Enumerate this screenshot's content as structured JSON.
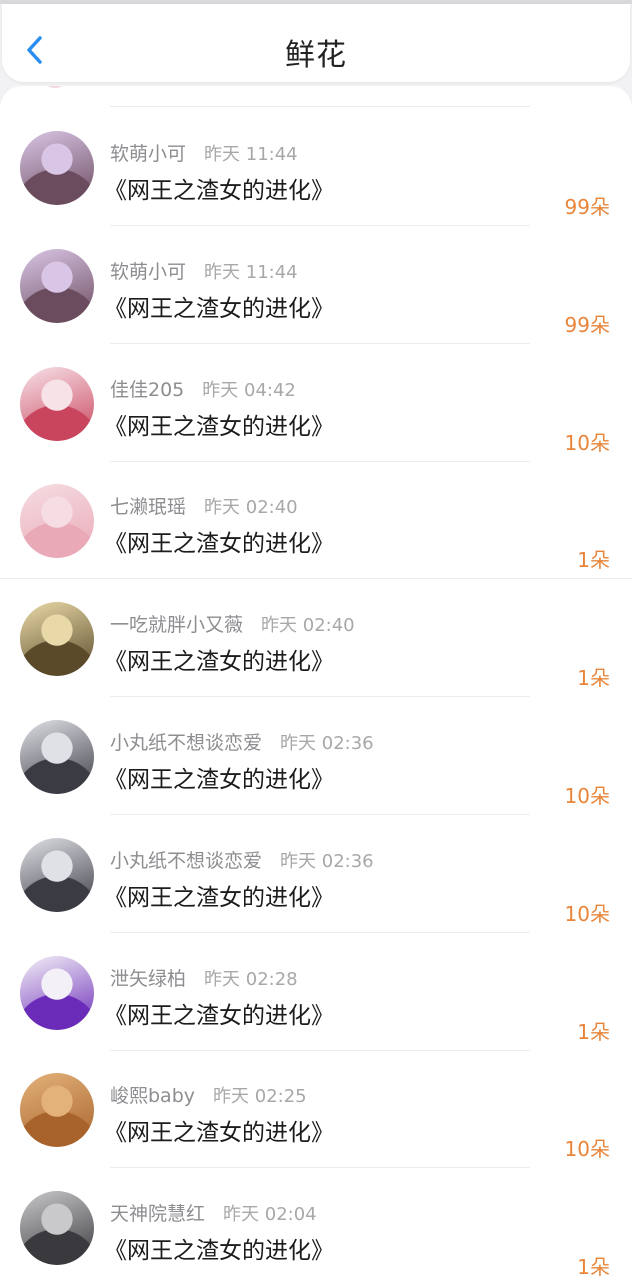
{
  "header": {
    "title": "鲜花",
    "back_icon": "chevron-left-icon",
    "accent": "#2a8ef0"
  },
  "colors": {
    "count": "#e8853a",
    "name": "#8e8e92"
  },
  "items": [
    {
      "name": "软萌小可",
      "time": "昨天 11:44",
      "book": "《网王之渣女的进化》",
      "count": "99朵",
      "avatar": "anime-girl-avatar",
      "palette": [
        "#d9c6e6",
        "#6b4b5e"
      ]
    },
    {
      "name": "软萌小可",
      "time": "昨天 11:44",
      "book": "《网王之渣女的进化》",
      "count": "99朵",
      "avatar": "anime-girl-avatar",
      "palette": [
        "#d9c6e6",
        "#6b4b5e"
      ]
    },
    {
      "name": "佳佳205",
      "time": "昨天 04:42",
      "book": "《网王之渣女的进化》",
      "count": "10朵",
      "avatar": "flower-girl-avatar",
      "palette": [
        "#f7e2e8",
        "#c9455e"
      ]
    },
    {
      "name": "七濑珉瑶",
      "time": "昨天 02:40",
      "book": "《网王之渣女的进化》",
      "count": "1朵",
      "avatar": "pink-hair-avatar",
      "palette": [
        "#f6dde3",
        "#e9a9b6"
      ]
    },
    {
      "name": "一吃就胖小又薇",
      "time": "昨天 02:40",
      "book": "《网王之渣女的进化》",
      "count": "1朵",
      "avatar": "cookie-avatar",
      "palette": [
        "#e9d9a8",
        "#5a4a2a"
      ]
    },
    {
      "name": "小丸纸不想谈恋爱",
      "time": "昨天 02:36",
      "book": "《网王之渣女的进化》",
      "count": "10朵",
      "avatar": "dark-hair-girl-avatar",
      "palette": [
        "#dfe1e6",
        "#3b3b44"
      ]
    },
    {
      "name": "小丸纸不想谈恋爱",
      "time": "昨天 02:36",
      "book": "《网王之渣女的进化》",
      "count": "10朵",
      "avatar": "dark-hair-girl-avatar",
      "palette": [
        "#dfe1e6",
        "#3b3b44"
      ]
    },
    {
      "name": "泄矢绿柏",
      "time": "昨天 02:28",
      "book": "《网王之渣女的进化》",
      "count": "1朵",
      "avatar": "purple-chibi-avatar",
      "palette": [
        "#f4f0f7",
        "#6a2bb8"
      ]
    },
    {
      "name": "峻熙baby",
      "time": "昨天 02:25",
      "book": "《网王之渣女的进化》",
      "count": "10朵",
      "avatar": "dog-avatar",
      "palette": [
        "#e3b27a",
        "#a8632c"
      ]
    },
    {
      "name": "天神院慧红",
      "time": "昨天 02:04",
      "book": "《网王之渣女的进化》",
      "count": "1朵",
      "avatar": "couple-photo-avatar",
      "palette": [
        "#c9c9cc",
        "#3a3a3e"
      ]
    }
  ]
}
